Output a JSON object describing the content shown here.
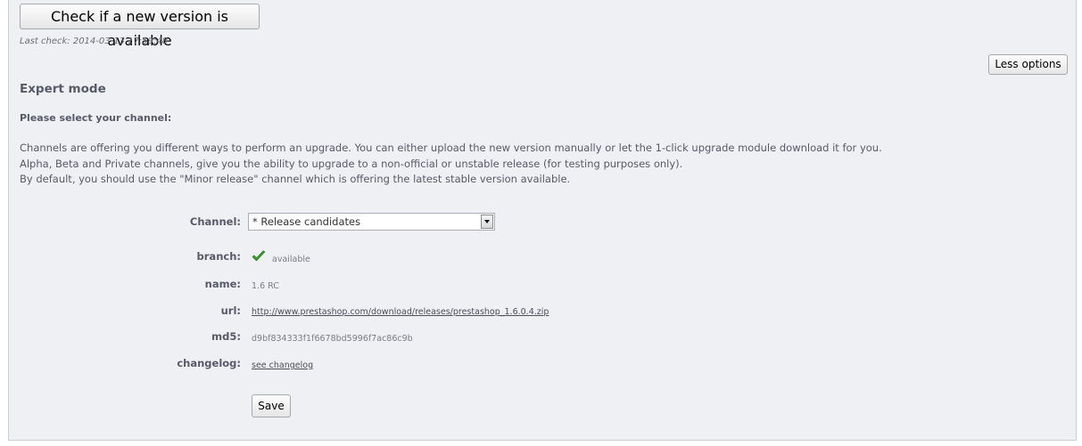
{
  "header": {
    "check_button_label": "Check if a new version is available",
    "last_check": "Last check: 2014-03-13 17:59:48",
    "less_options_label": "Less options"
  },
  "expert": {
    "title": "Expert mode",
    "select_channel_prompt": "Please select your channel:",
    "description": [
      "Channels are offering you different ways to perform an upgrade. You can either upload the new version manually or let the 1-click upgrade module download it for you.",
      "Alpha, Beta and Private channels, give you the ability to upgrade to a non-official or unstable release (for testing purposes only).",
      "By default, you should use the \"Minor release\" channel which is offering the latest stable version available."
    ]
  },
  "form": {
    "channel": {
      "label": "Channel:",
      "selected": "* Release candidates"
    },
    "branch": {
      "label": "branch:",
      "value": "available",
      "icon": "check-icon",
      "icon_color": "#3a9a2a"
    },
    "name": {
      "label": "name:",
      "value": "1.6 RC"
    },
    "url": {
      "label": "url:",
      "value": "http://www.prestashop.com/download/releases/prestashop_1.6.0.4.zip"
    },
    "md5": {
      "label": "md5:",
      "value": "d9bf834333f1f6678bd5996f7ac86c9b"
    },
    "changelog": {
      "label": "changelog:",
      "value": "see changelog"
    },
    "save_label": "Save"
  }
}
